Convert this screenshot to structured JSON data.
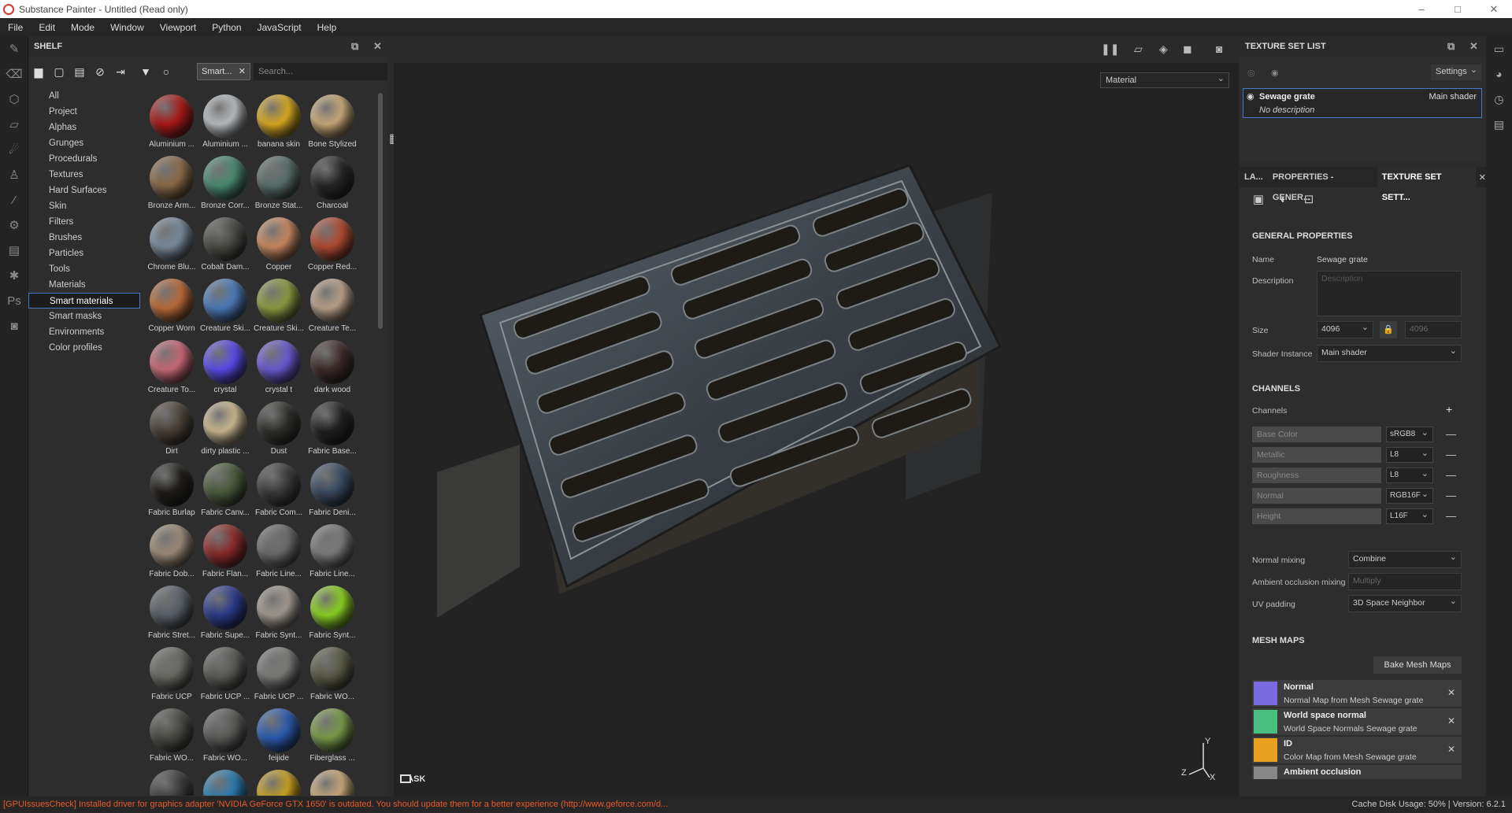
{
  "app": {
    "title": "Substance Painter - Untitled (Read only)",
    "window_controls": [
      "–",
      "□",
      "✕"
    ]
  },
  "menu": [
    "File",
    "Edit",
    "Mode",
    "Window",
    "Viewport",
    "Python",
    "JavaScript",
    "Help"
  ],
  "shelf": {
    "title": "SHELF",
    "filter_chip": "Smart...",
    "search_placeholder": "Search...",
    "categories": [
      "All",
      "Project",
      "Alphas",
      "Grunges",
      "Procedurals",
      "Textures",
      "Hard Surfaces",
      "Skin",
      "Filters",
      "Brushes",
      "Particles",
      "Tools",
      "Materials",
      "Smart materials",
      "Smart masks",
      "Environments",
      "Color profiles"
    ],
    "selected_category": "Smart materials",
    "materials": [
      {
        "label": "Aluminium ...",
        "color": "#a81818"
      },
      {
        "label": "Aluminium ...",
        "color": "#b8bcc0"
      },
      {
        "label": "banana skin",
        "color": "#d8a820"
      },
      {
        "label": "Bone Stylized",
        "color": "#c8a878"
      },
      {
        "label": "Bronze Arm...",
        "color": "#8a6a48"
      },
      {
        "label": "Bronze Corr...",
        "color": "#4a8a72"
      },
      {
        "label": "Bronze Stat...",
        "color": "#5a6e6a"
      },
      {
        "label": "Charcoal",
        "color": "#262626"
      },
      {
        "label": "Chrome Blu...",
        "color": "#7a8a9a"
      },
      {
        "label": "Cobalt Dam...",
        "color": "#4a4a44"
      },
      {
        "label": "Copper",
        "color": "#c88860"
      },
      {
        "label": "Copper Red...",
        "color": "#b04a30"
      },
      {
        "label": "Copper Worn",
        "color": "#b86a38"
      },
      {
        "label": "Creature Ski...",
        "color": "#4a7ab8"
      },
      {
        "label": "Creature Ski...",
        "color": "#8a9a40"
      },
      {
        "label": "Creature Te...",
        "color": "#b8a088"
      },
      {
        "label": "Creature To...",
        "color": "#c86878"
      },
      {
        "label": "crystal",
        "color": "#5a4ae8"
      },
      {
        "label": "crystal t",
        "color": "#6a5ad0"
      },
      {
        "label": "dark wood",
        "color": "#3a2a28"
      },
      {
        "label": "Dirt",
        "color": "#4a4038"
      },
      {
        "label": "dirty plastic ...",
        "color": "#c8b890"
      },
      {
        "label": "Dust",
        "color": "#2e2e2a"
      },
      {
        "label": "Fabric Base...",
        "color": "#202020"
      },
      {
        "label": "Fabric Burlap",
        "color": "#1e1c18"
      },
      {
        "label": "Fabric Canv...",
        "color": "#4a5a3a"
      },
      {
        "label": "Fabric Com...",
        "color": "#3a3a3c"
      },
      {
        "label": "Fabric Deni...",
        "color": "#3a4a62"
      },
      {
        "label": "Fabric Dob...",
        "color": "#9a8a78"
      },
      {
        "label": "Fabric Flan...",
        "color": "#8a2a2a"
      },
      {
        "label": "Fabric Line...",
        "color": "#6a6a6a"
      },
      {
        "label": "Fabric Line...",
        "color": "#7a7a7a"
      },
      {
        "label": "Fabric Stret...",
        "color": "#5a6068"
      },
      {
        "label": "Fabric Supe...",
        "color": "#2a3a8a"
      },
      {
        "label": "Fabric Synt...",
        "color": "#a09890"
      },
      {
        "label": "Fabric Synt...",
        "color": "#8ad020"
      },
      {
        "label": "Fabric UCP",
        "color": "#6a6a64"
      },
      {
        "label": "Fabric UCP ...",
        "color": "#5a5a56"
      },
      {
        "label": "Fabric UCP ...",
        "color": "#7a7a78"
      },
      {
        "label": "Fabric WO...",
        "color": "#5a5a48"
      },
      {
        "label": "Fabric WO...",
        "color": "#4a4a44"
      },
      {
        "label": "Fabric WO...",
        "color": "#5a5a58"
      },
      {
        "label": "feijide",
        "color": "#2a5ab0"
      },
      {
        "label": "Fiberglass ...",
        "color": "#7a9a48"
      },
      {
        "label": "",
        "color": "#3a3a3a"
      },
      {
        "label": "",
        "color": "#2a7ab0"
      },
      {
        "label": "",
        "color": "#c8a020"
      },
      {
        "label": "",
        "color": "#c8a878"
      }
    ]
  },
  "viewport": {
    "material_select": "Material",
    "mask_label": "MASK",
    "gizmo": {
      "y": "Y",
      "z": "Z",
      "x": "X"
    }
  },
  "texture_set_list": {
    "title": "TEXTURE SET LIST",
    "settings_label": "Settings",
    "item": {
      "name": "Sewage grate",
      "shader": "Main shader",
      "description": "No description"
    }
  },
  "properties": {
    "tabs": [
      "LA...",
      "PROPERTIES - GENER...",
      "TEXTURE SET SETT..."
    ],
    "general_title": "GENERAL PROPERTIES",
    "name_label": "Name",
    "name_value": "Sewage grate",
    "description_label": "Description",
    "description_placeholder": "Description",
    "size_label": "Size",
    "size_value": "4096",
    "size_value2": "4096",
    "shader_label": "Shader Instance",
    "shader_value": "Main shader",
    "channels_title": "CHANNELS",
    "channels_label": "Channels",
    "channels": [
      {
        "name": "Base Color",
        "format": "sRGB8"
      },
      {
        "name": "Metallic",
        "format": "L8"
      },
      {
        "name": "Roughness",
        "format": "L8"
      },
      {
        "name": "Normal",
        "format": "RGB16F"
      },
      {
        "name": "Height",
        "format": "L16F"
      }
    ],
    "normal_mixing_label": "Normal mixing",
    "normal_mixing_value": "Combine",
    "ao_mixing_label": "Ambient occlusion mixing",
    "ao_mixing_value": "Multiply",
    "uv_padding_label": "UV padding",
    "uv_padding_value": "3D Space Neighbor",
    "mesh_maps_title": "MESH MAPS",
    "bake_label": "Bake Mesh Maps",
    "mesh_maps": [
      {
        "name": "Normal",
        "desc": "Normal Map from Mesh Sewage grate",
        "color": "#7a6ae0"
      },
      {
        "name": "World space normal",
        "desc": "World Space Normals Sewage grate",
        "color": "#4ac080"
      },
      {
        "name": "ID",
        "desc": "Color Map from Mesh Sewage grate",
        "color": "#e8a020"
      },
      {
        "name": "Ambient occlusion",
        "desc": "",
        "color": "#888888"
      }
    ]
  },
  "status": {
    "error": "[GPUIssuesCheck] Installed driver for graphics adapter 'NVIDIA GeForce GTX 1650' is outdated. You should update them for a better experience (http://www.geforce.com/d...",
    "right": "Cache Disk Usage:    50% | Version: 6.2.1"
  }
}
